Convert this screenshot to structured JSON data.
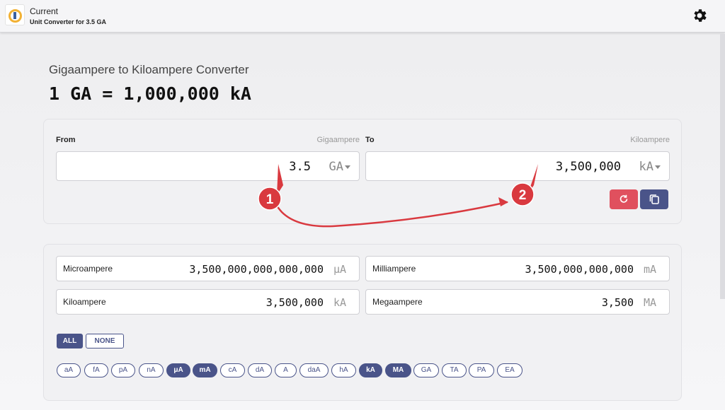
{
  "header": {
    "title": "Current",
    "subtitle": "Unit Converter for 3.5 GA",
    "logo_icon": "current-logo-icon",
    "settings_icon": "gear-icon"
  },
  "converter": {
    "heading": "Gigaampere to Kiloampere Converter",
    "formula": "1 GA = 1,000,000 kA",
    "from": {
      "label": "From",
      "unit_name": "Gigaampere",
      "value": "3.5",
      "unit": "GA"
    },
    "to": {
      "label": "To",
      "unit_name": "Kiloampere",
      "value": "3,500,000",
      "unit": "kA"
    },
    "reset_icon": "refresh-icon",
    "copy_icon": "copy-icon"
  },
  "results": [
    {
      "name": "Microampere",
      "value": "3,500,000,000,000,000",
      "unit": "μA"
    },
    {
      "name": "Milliampere",
      "value": "3,500,000,000,000",
      "unit": "mA"
    },
    {
      "name": "Kiloampere",
      "value": "3,500,000",
      "unit": "kA"
    },
    {
      "name": "Megaampere",
      "value": "3,500",
      "unit": "MA"
    }
  ],
  "select": {
    "all": "ALL",
    "none": "NONE"
  },
  "units": [
    {
      "label": "aA",
      "active": false
    },
    {
      "label": "fA",
      "active": false
    },
    {
      "label": "pA",
      "active": false
    },
    {
      "label": "nA",
      "active": false
    },
    {
      "label": "μA",
      "active": true
    },
    {
      "label": "mA",
      "active": true
    },
    {
      "label": "cA",
      "active": false
    },
    {
      "label": "dA",
      "active": false
    },
    {
      "label": "A",
      "active": false
    },
    {
      "label": "daA",
      "active": false
    },
    {
      "label": "hA",
      "active": false
    },
    {
      "label": "kA",
      "active": true
    },
    {
      "label": "MA",
      "active": true
    },
    {
      "label": "GA",
      "active": false
    },
    {
      "label": "TA",
      "active": false
    },
    {
      "label": "PA",
      "active": false
    },
    {
      "label": "EA",
      "active": false
    }
  ],
  "annotations": [
    {
      "label": "1",
      "color": "#d9393f"
    },
    {
      "label": "2",
      "color": "#d9393f"
    }
  ],
  "colors": {
    "accent": "#4a5489",
    "danger": "#e0505e",
    "annotation": "#d9393f"
  }
}
